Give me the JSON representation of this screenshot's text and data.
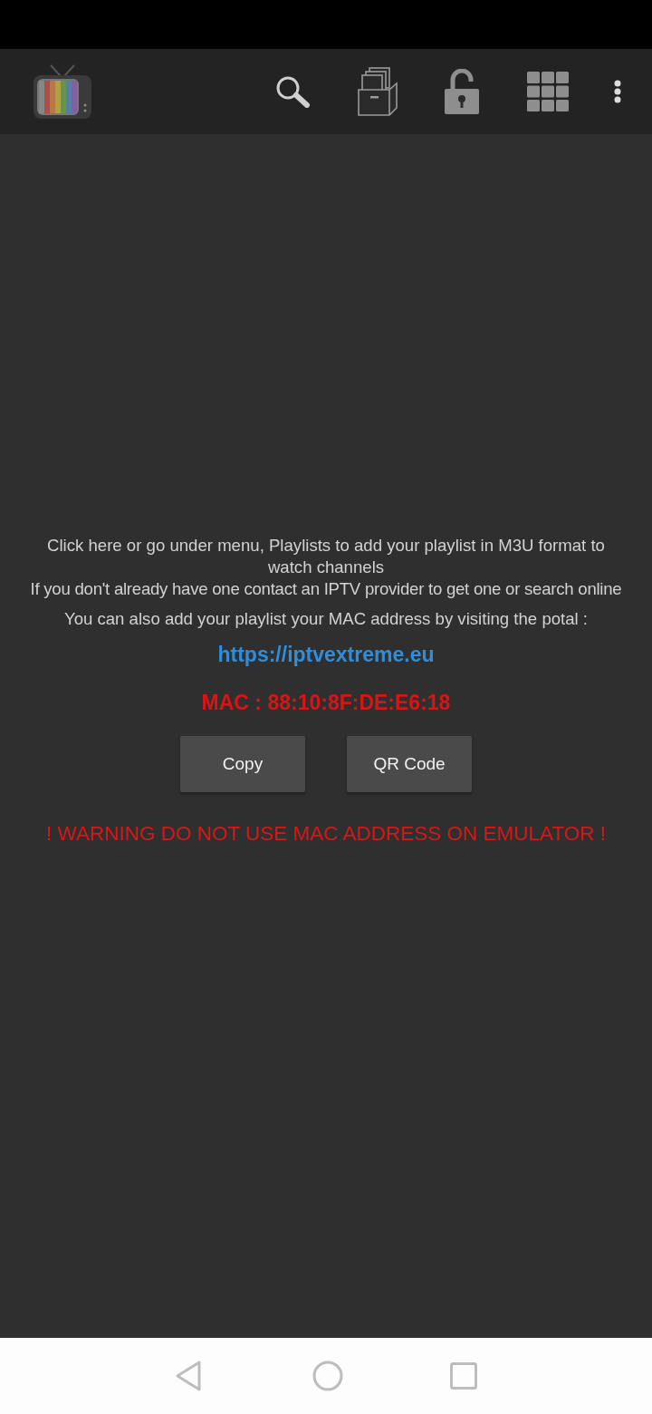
{
  "message": {
    "instructions": "Click here or go under menu, Playlists to add your playlist in M3U format to watch channels",
    "help": "If you don't already have one contact an IPTV provider to get one or search online",
    "portal_prompt": "You can also add your playlist your MAC address by visiting the potal :",
    "portal_link": "https://iptvextreme.eu",
    "mac_address": "MAC : 88:10:8F:DE:E6:18",
    "buttons": [
      "Copy",
      "QR Code"
    ],
    "warning": "! WARNING DO NOT USE MAC ADDRESS ON EMULATOR !"
  }
}
